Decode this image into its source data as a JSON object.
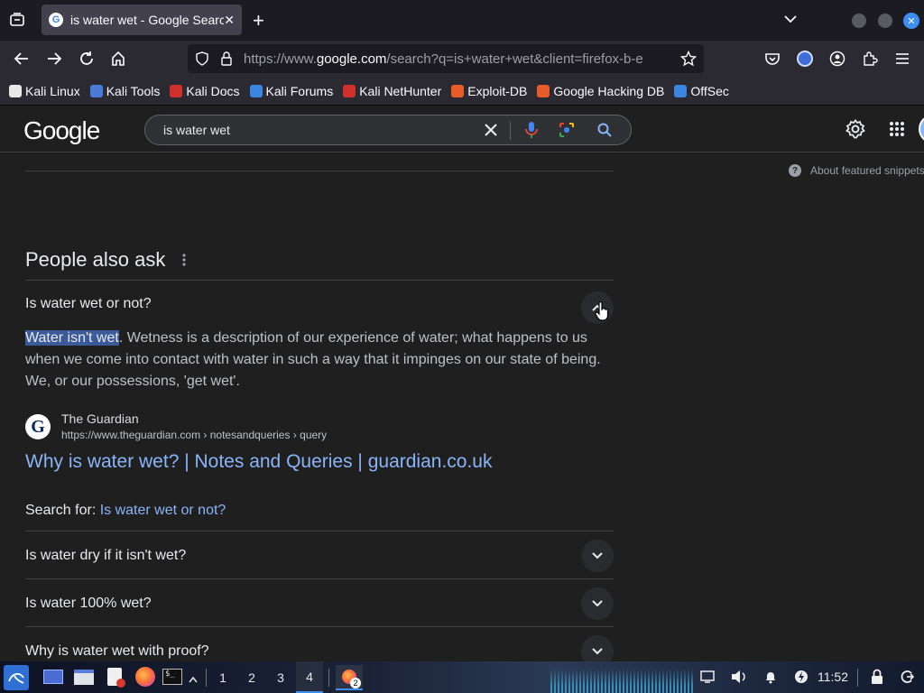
{
  "browser": {
    "tab_title": "is water wet - Google Search",
    "url_prefix": "https://www.",
    "url_domain": "google.com",
    "url_rest": "/search?q=is+water+wet&client=firefox-b-e",
    "bookmarks": [
      {
        "label": "Kali Linux",
        "icon": "kali-linux-icon",
        "color": "#e8e8e8"
      },
      {
        "label": "Kali Tools",
        "icon": "kali-tools-icon",
        "color": "#4a7bd8"
      },
      {
        "label": "Kali Docs",
        "icon": "kali-docs-icon",
        "color": "#d0302b"
      },
      {
        "label": "Kali Forums",
        "icon": "kali-forums-icon",
        "color": "#3b86e0"
      },
      {
        "label": "Kali NetHunter",
        "icon": "kali-nethunter-icon",
        "color": "#d0302b"
      },
      {
        "label": "Exploit-DB",
        "icon": "exploit-db-icon",
        "color": "#e85c2a"
      },
      {
        "label": "Google Hacking DB",
        "icon": "google-hacking-db-icon",
        "color": "#e85c2a"
      },
      {
        "label": "OffSec",
        "icon": "offsec-icon",
        "color": "#3b86e0"
      }
    ]
  },
  "google": {
    "logo": "Google",
    "query": "is water wet",
    "about_snippets": "About featured snippets",
    "paa_title": "People also ask",
    "q1": "Is water wet or not?",
    "answer_highlight": "Water isn't wet",
    "answer_line1": ". Wetness is a description of our experience of water; what happens to us",
    "answer_line2": "when we come into contact with water in such a way that it impinges on our state of being.",
    "answer_line3": "We, or our possessions, 'get wet'.",
    "source_name": "The Guardian",
    "source_url": "https://www.theguardian.com › notesandqueries › query",
    "result_link": "Why is water wet? | Notes and Queries | guardian.co.uk",
    "search_for_label": "Search for: ",
    "search_for_link": "Is water wet or not?",
    "q2": "Is water dry if it isn't wet?",
    "q3": "Is water 100% wet?",
    "q4": "Why is water wet with proof?"
  },
  "taskbar": {
    "workspaces": [
      "1",
      "2",
      "3",
      "4"
    ],
    "active_workspace": "4",
    "badge": "2",
    "clock": "11:52"
  },
  "colors": {
    "link": "#8ab4f8",
    "highlight": "#3c5a9a"
  }
}
